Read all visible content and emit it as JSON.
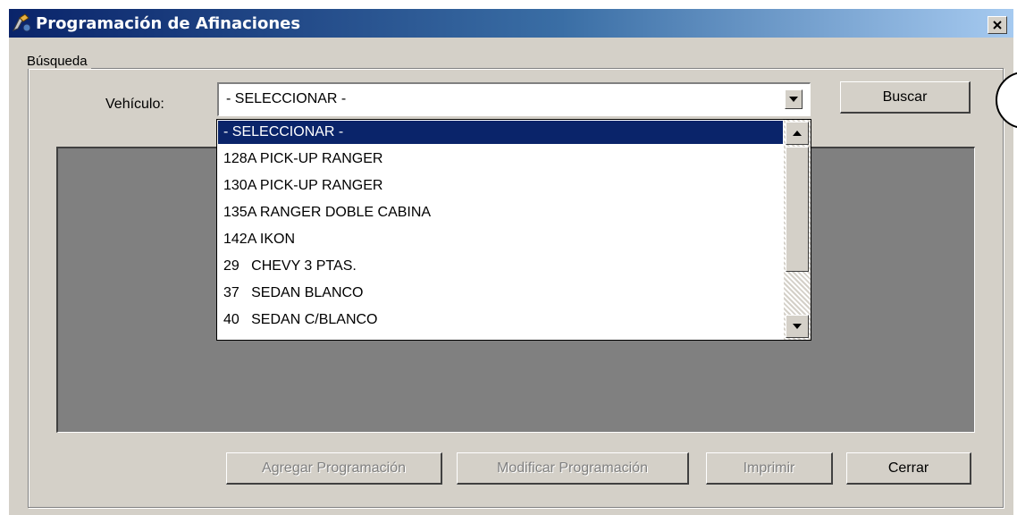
{
  "window": {
    "title": "Programación de Afinaciones",
    "icon": "app-icon",
    "close_label": "×"
  },
  "search_group": {
    "legend": "Búsqueda",
    "vehicle_label": "Vehículo:",
    "vehicle_value": "- SELECCIONAR -",
    "search_button": "Buscar"
  },
  "vehicle_dropdown": {
    "options": [
      "- SELECCIONAR -",
      "128A PICK-UP RANGER",
      "130A PICK-UP RANGER",
      "135A RANGER DOBLE CABINA",
      "142A IKON",
      "29   CHEVY 3 PTAS.",
      "37   SEDAN BLANCO",
      "40   SEDAN C/BLANCO"
    ],
    "selected_index": 0
  },
  "actions": {
    "add": "Agregar Programación",
    "modify": "Modificar Programación",
    "print": "Imprimir",
    "close": "Cerrar"
  },
  "colors": {
    "titlebar_start": "#0a246a",
    "titlebar_end": "#a6caf0",
    "selection": "#0a246a",
    "window_bg": "#d4d0c8",
    "grid_bg": "#808080"
  }
}
